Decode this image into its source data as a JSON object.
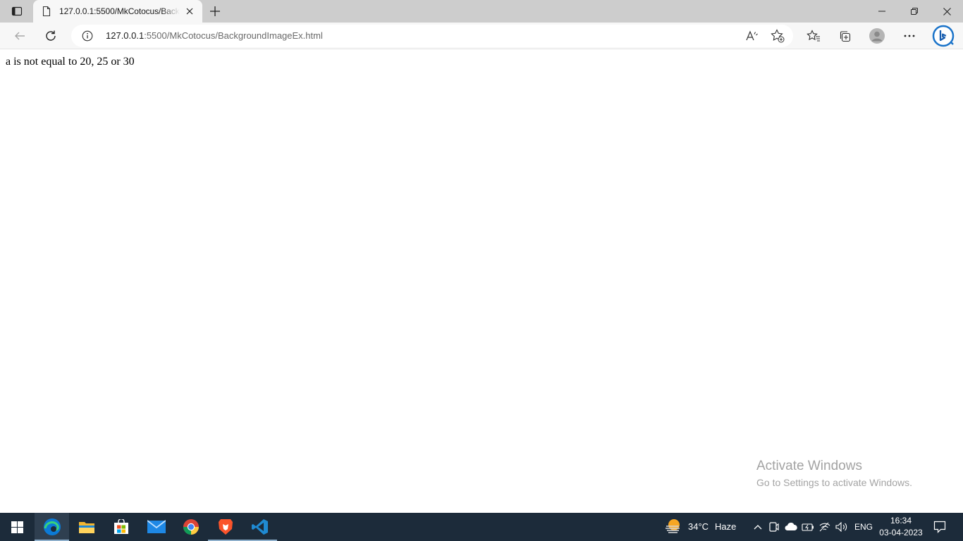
{
  "browser": {
    "tab": {
      "title": "127.0.0.1:5500/MkCotocus/BackgroundImageEx.html"
    },
    "address": {
      "host": "127.0.0.1",
      "rest": ":5500/MkCotocus/BackgroundImageEx.html"
    },
    "icons": {
      "tab_actions": "tab-actions-icon",
      "page": "page-icon",
      "close": "close-icon",
      "new_tab": "plus-icon",
      "back": "back-arrow-icon",
      "refresh": "refresh-icon",
      "info": "info-icon",
      "read_aloud": "read-aloud-icon",
      "add_favorite": "add-favorite-icon",
      "favorites": "favorites-icon",
      "collections": "collections-icon",
      "profile": "profile-icon",
      "more": "more-icon",
      "bing": "bing-icon"
    }
  },
  "page": {
    "text": "a is not equal to 20, 25 or 30"
  },
  "watermark": {
    "title": "Activate Windows",
    "subtitle": "Go to Settings to activate Windows."
  },
  "taskbar": {
    "apps": [
      "start",
      "edge",
      "file-explorer",
      "microsoft-store",
      "mail",
      "chrome",
      "brave",
      "vscode"
    ],
    "weather": {
      "temp": "34°C",
      "condition": "Haze"
    },
    "language": "ENG",
    "time": "16:34",
    "date": "03-04-2023"
  },
  "colors": {
    "tabbar": "#cdcdcd",
    "toolbar": "#f7f7f7",
    "taskbar": "#1c2b3a",
    "edge_accent": "#0c7ad6"
  }
}
